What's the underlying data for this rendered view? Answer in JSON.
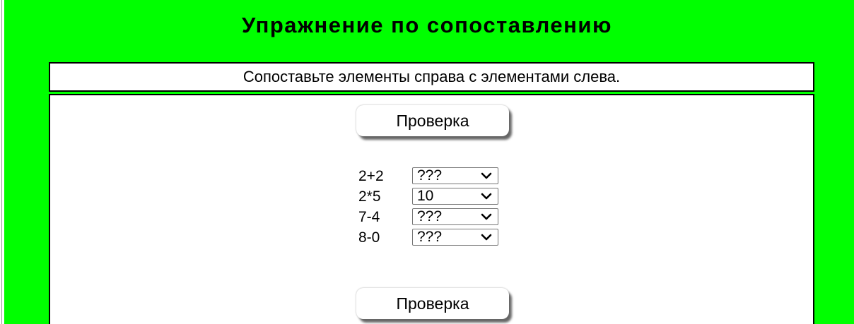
{
  "exercise": {
    "title": "Упражнение по сопоставлению",
    "instructions": "Сопоставьте элементы справа с элементами слева.",
    "check_label_top": "Проверка",
    "check_label_bottom": "Проверка",
    "items": [
      {
        "label": "2+2",
        "selected": "???"
      },
      {
        "label": "2*5",
        "selected": "10"
      },
      {
        "label": "7-4",
        "selected": "???"
      },
      {
        "label": "8-0",
        "selected": "???"
      }
    ]
  },
  "colors": {
    "background": "#00ff00",
    "panel": "#ffffff",
    "border": "#000000"
  },
  "icons": {
    "dropdown": "chevron-down-icon"
  }
}
